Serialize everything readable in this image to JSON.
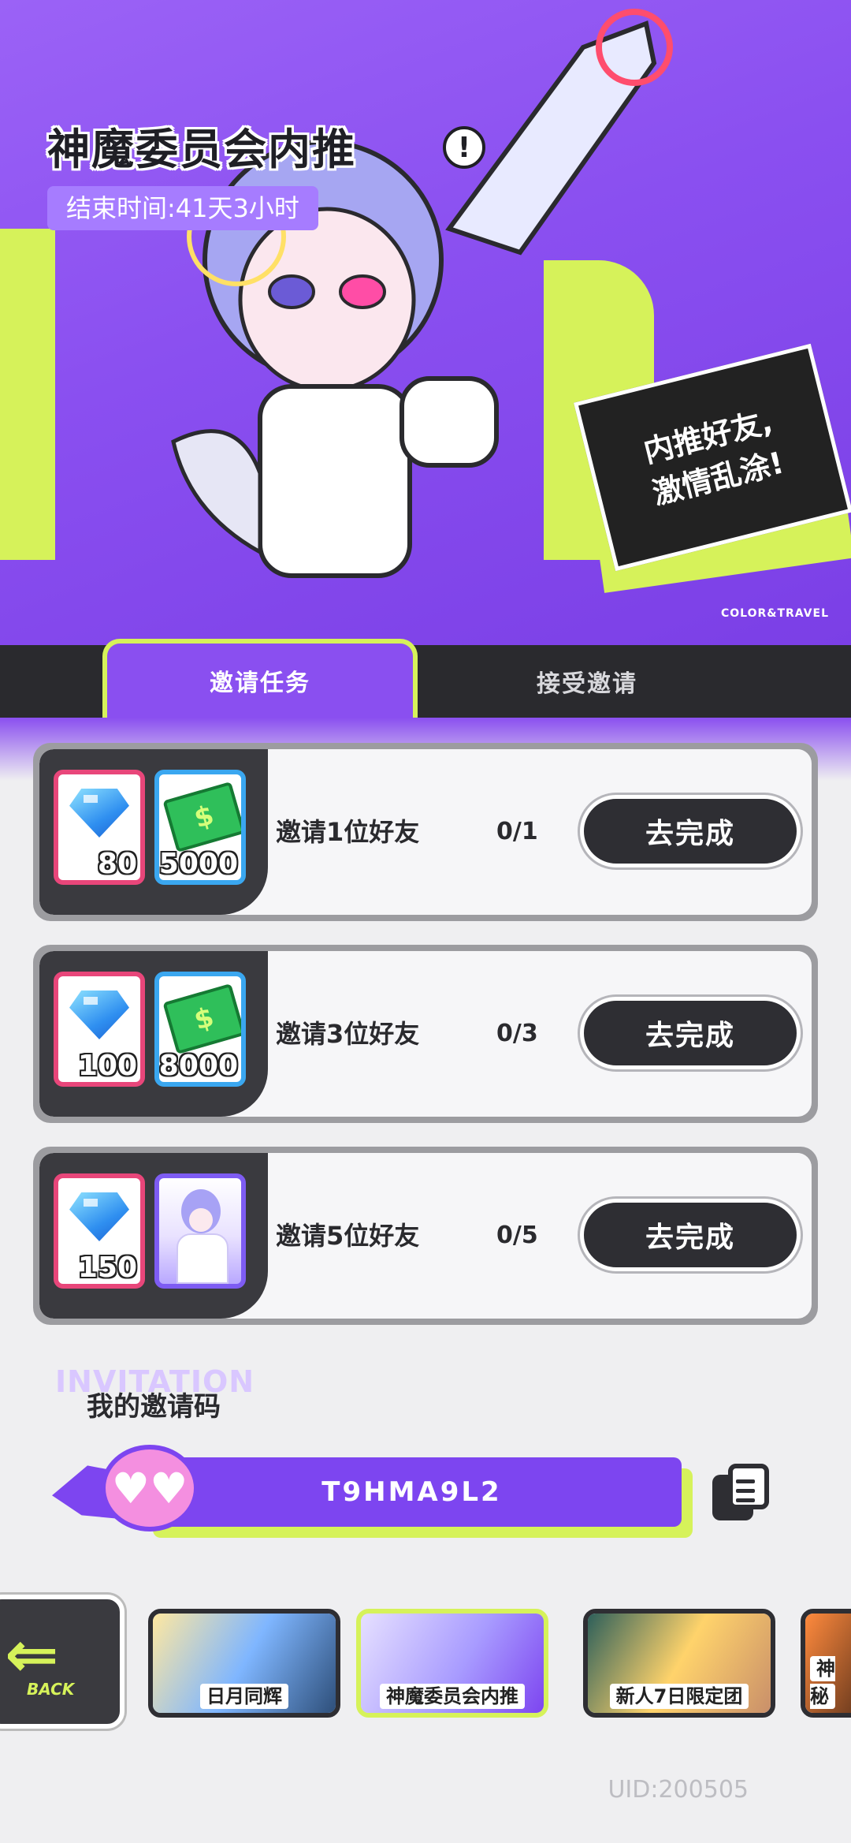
{
  "banner": {
    "title": "神魔委员会内推",
    "end_time": "结束时间:41天3小时",
    "slogan_line1": "内推好友,",
    "slogan_line2": "激情乱涂!",
    "brand": "COLOR&TRAVEL"
  },
  "tabs": [
    {
      "label": "邀请任务",
      "active": true
    },
    {
      "label": "接受邀请",
      "active": false
    }
  ],
  "tasks": [
    {
      "label": "邀请1位好友",
      "progress": "0/1",
      "button": "去完成",
      "rewards": [
        {
          "type": "gem-icon",
          "qty": "80"
        },
        {
          "type": "cash-icon",
          "qty": "5000"
        }
      ]
    },
    {
      "label": "邀请3位好友",
      "progress": "0/3",
      "button": "去完成",
      "rewards": [
        {
          "type": "gem-icon",
          "qty": "100"
        },
        {
          "type": "cash-icon",
          "qty": "8000"
        }
      ]
    },
    {
      "label": "邀请5位好友",
      "progress": "0/5",
      "button": "去完成",
      "rewards": [
        {
          "type": "gem-icon",
          "qty": "150"
        },
        {
          "type": "character-card",
          "qty": ""
        }
      ]
    }
  ],
  "invite": {
    "bg_word": "INVITATION",
    "title": "我的邀请码",
    "code": "T9HMA9L2"
  },
  "nav": {
    "back_label": "BACK",
    "items": [
      {
        "label": "日月同辉",
        "active": false
      },
      {
        "label": "神魔委员会内推",
        "active": true
      },
      {
        "label": "新人7日限定团",
        "active": false
      },
      {
        "label": "神秘",
        "active": false
      }
    ]
  },
  "uid": "UID:200505",
  "colors": {
    "accent_purple": "#8a4ff0",
    "accent_lime": "#d6f25a",
    "dark": "#2e2e33"
  }
}
